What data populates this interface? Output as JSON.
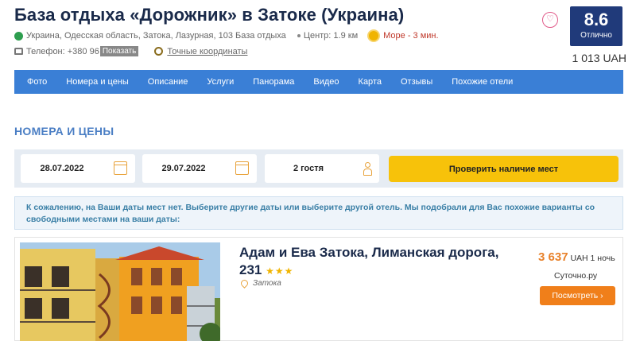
{
  "hotel": {
    "title": "База отдыха «Дорожник» в Затоке (Украина)",
    "address": "Украина, Одесская область, Затока, Лазурная, 103 База отдыха",
    "center_distance": "Центр: 1.9 км",
    "sea_distance": "Море - 3 мин.",
    "phone_prefix": "Телефон: +380 96",
    "show_phone_label": "Показать",
    "coords_link": "Точные координаты",
    "rating_value": "8.6",
    "rating_label": "Отлично",
    "price": "1 013 UAH"
  },
  "nav": {
    "items": [
      "Фото",
      "Номера и цены",
      "Описание",
      "Услуги",
      "Панорама",
      "Видео",
      "Карта",
      "Отзывы",
      "Похожие отели"
    ]
  },
  "rooms": {
    "section_title": "НОМЕРА И ЦЕНЫ",
    "checkin": "28.07.2022",
    "checkout": "29.07.2022",
    "guests": "2 гостя",
    "check_button": "Проверить наличие мест",
    "notice": "К сожалению, на Ваши даты мест нет. Выберите другие даты или выберите другой отель. Мы подобрали для Вас похожие варианты со свободными местами на ваши даты:"
  },
  "similar": {
    "name": "Адам и Ева Затока, Лиманская дорога, 231",
    "stars": "★★★",
    "location": "Затока",
    "price_amount": "3 637",
    "price_unit": "UAH 1 ночь",
    "provider": "Суточно.ру",
    "view_button": "Посмотреть ›"
  },
  "colors": {
    "nav_bg": "#3a7fd6",
    "rating_bg": "#203a7a",
    "check_button": "#f7c20a",
    "view_button": "#f07f1a",
    "price_accent": "#e8812a",
    "section_title": "#4a7ec4"
  },
  "icons": {
    "address": "globe-icon",
    "sea": "sun-icon",
    "phone": "phone-icon",
    "coords": "clock-icon",
    "favorite": "heart-icon",
    "date": "calendar-icon",
    "guests": "person-icon",
    "location": "pin-icon"
  }
}
